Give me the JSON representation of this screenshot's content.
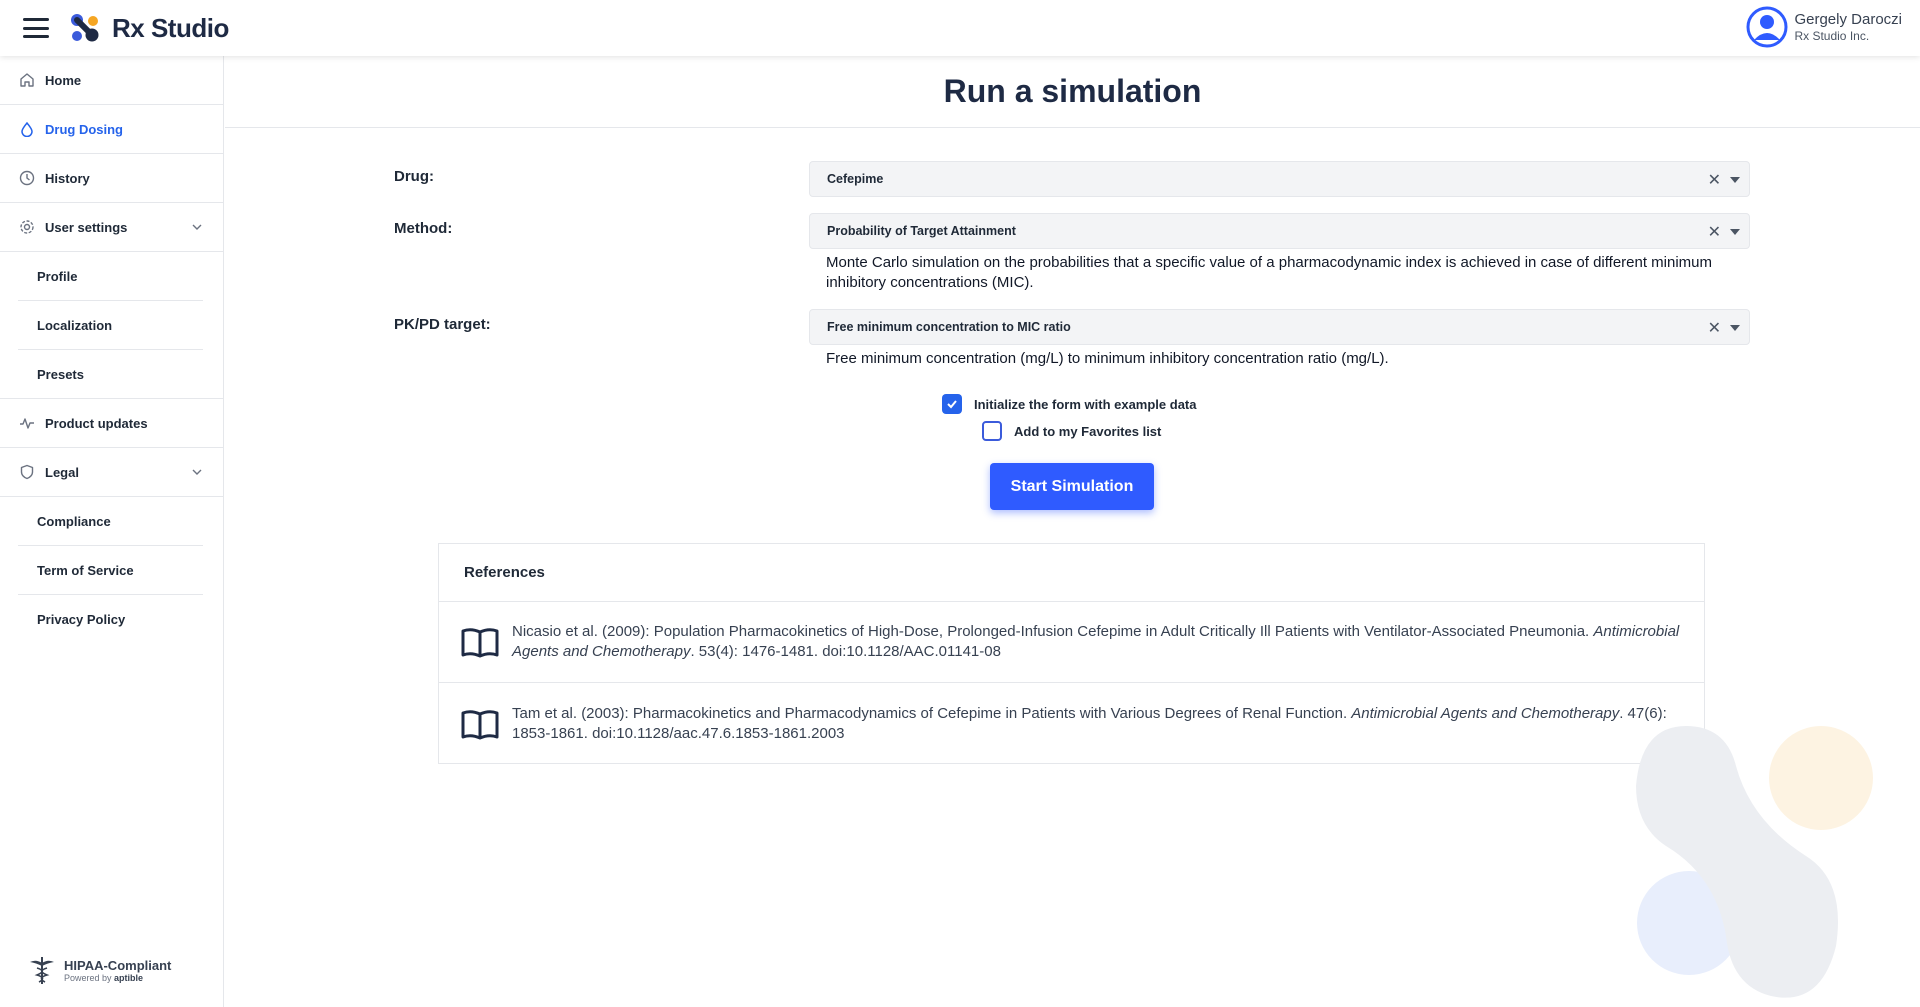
{
  "header": {
    "app_name": "Rx Studio",
    "user_name": "Gergely Daroczi",
    "user_org": "Rx Studio Inc."
  },
  "sidebar": {
    "items": [
      {
        "label": "Home",
        "icon": "home-icon"
      },
      {
        "label": "Drug Dosing",
        "icon": "drop-icon",
        "active": true
      },
      {
        "label": "History",
        "icon": "clock-icon"
      },
      {
        "label": "User settings",
        "icon": "gear-icon",
        "expanded": true
      },
      {
        "label": "Profile"
      },
      {
        "label": "Localization"
      },
      {
        "label": "Presets"
      },
      {
        "label": "Product updates",
        "icon": "pulse-icon"
      },
      {
        "label": "Legal",
        "icon": "shield-icon",
        "expanded": true
      },
      {
        "label": "Compliance"
      },
      {
        "label": "Term of Service"
      },
      {
        "label": "Privacy Policy"
      }
    ],
    "hipaa_title": "HIPAA-Compliant",
    "hipaa_powered": "Powered by",
    "hipaa_brand": "aptible"
  },
  "main": {
    "title": "Run a simulation",
    "drug": {
      "label": "Drug:",
      "value": "Cefepime"
    },
    "method": {
      "label": "Method:",
      "value": "Probability of Target Attainment",
      "description": "Monte Carlo simulation on the probabilities that a specific value of a pharmacodynamic index is achieved in case of different minimum inhibitory concentrations (MIC)."
    },
    "target": {
      "label": "PK/PD target:",
      "value": "Free minimum concentration to MIC ratio",
      "description": "Free minimum concentration (mg/L) to minimum inhibitory concentration ratio (mg/L)."
    },
    "checkbox_example": {
      "label": "Initialize the form with example data",
      "checked": true
    },
    "checkbox_favorites": {
      "label": "Add to my Favorites list",
      "checked": false
    },
    "start_button": "Start Simulation",
    "references": {
      "heading": "References",
      "items": [
        {
          "text": "Nicasio et al. (2009): Population Pharmacokinetics of High-Dose, Prolonged-Infusion Cefepime in Adult Critically Ill Patients with Ventilator-Associated Pneumonia.",
          "journal": "Antimicrobial Agents and Chemotherapy",
          "tail": ". 53(4): 1476-1481. doi:10.1128/AAC.01141-08"
        },
        {
          "text": "Tam et al. (2003): Pharmacokinetics and Pharmacodynamics of Cefepime in Patients with Various Degrees of Renal Function.",
          "journal": "Antimicrobial Agents and Chemotherapy",
          "tail": ". 47(6): 1853-1861. doi:10.1128/aac.47.6.1853-1861.2003"
        }
      ]
    }
  },
  "colors": {
    "accent": "#2f5bff",
    "active_nav": "#2563eb",
    "logo_blue": "#3b5bdb",
    "logo_orange": "#f5a623",
    "logo_dark": "#1e2a44"
  }
}
